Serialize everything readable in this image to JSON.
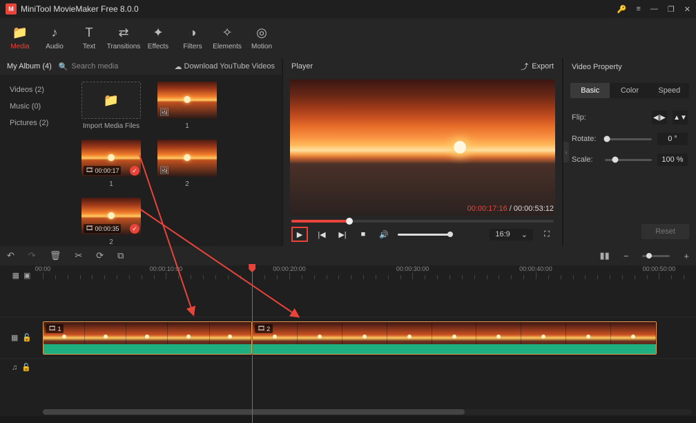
{
  "app": {
    "title": "MiniTool MovieMaker Free 8.0.0"
  },
  "toolbar": [
    {
      "id": "media",
      "label": "Media",
      "icon": "📁"
    },
    {
      "id": "audio",
      "label": "Audio",
      "icon": "♪"
    },
    {
      "id": "text",
      "label": "Text",
      "icon": "T"
    },
    {
      "id": "transitions",
      "label": "Transitions",
      "icon": "⇄"
    },
    {
      "id": "effects",
      "label": "Effects",
      "icon": "✦"
    },
    {
      "id": "filters",
      "label": "Filters",
      "icon": "◑"
    },
    {
      "id": "elements",
      "label": "Elements",
      "icon": "✧"
    },
    {
      "id": "motion",
      "label": "Motion",
      "icon": "◎"
    }
  ],
  "toolbar_active": "media",
  "mediabar": {
    "album": "My Album (4)",
    "search_placeholder": "Search media",
    "download": "Download YouTube Videos"
  },
  "categories": [
    {
      "label": "Videos (2)"
    },
    {
      "label": "Music (0)"
    },
    {
      "label": "Pictures (2)"
    }
  ],
  "thumbs": {
    "import_label": "Import Media Files",
    "items": [
      {
        "label": "1",
        "type": "picture"
      },
      {
        "label": "1",
        "type": "video",
        "duration": "00:00:17",
        "checked": true
      },
      {
        "label": "2",
        "type": "picture"
      },
      {
        "label": "2",
        "type": "video",
        "duration": "00:00:35",
        "checked": true
      }
    ]
  },
  "player": {
    "title": "Player",
    "export": "Export",
    "current": "00:00:17:16",
    "total": "00:00:53:12",
    "aspect": "16:9"
  },
  "props": {
    "title": "Video Property",
    "tabs": [
      "Basic",
      "Color",
      "Speed"
    ],
    "active_tab": "Basic",
    "flip_label": "Flip:",
    "rotate_label": "Rotate:",
    "rotate_value": "0 °",
    "scale_label": "Scale:",
    "scale_value": "100 %",
    "reset": "Reset"
  },
  "ruler": {
    "labels": [
      "00:00",
      "00:00:10:00",
      "00:00:20:00",
      "00:00:30:00",
      "00:00:40:00",
      "00:00:50:00"
    ]
  },
  "clips": [
    {
      "tag": "1"
    },
    {
      "tag": "2"
    }
  ]
}
